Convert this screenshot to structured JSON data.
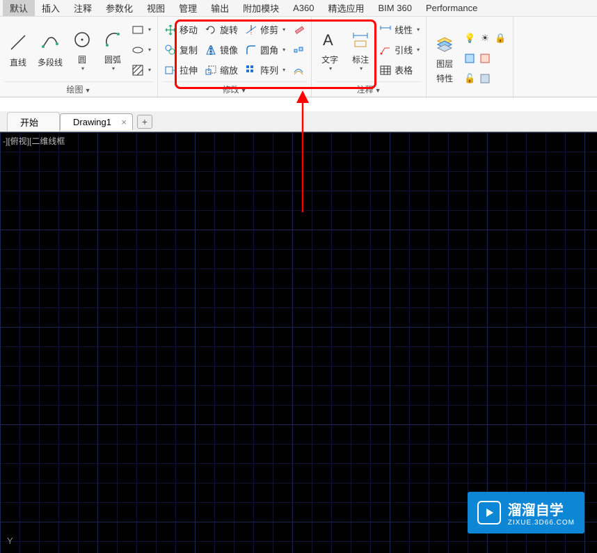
{
  "menus": [
    "默认",
    "插入",
    "注释",
    "参数化",
    "视图",
    "管理",
    "输出",
    "附加模块",
    "A360",
    "精选应用",
    "BIM 360",
    "Performance"
  ],
  "draw": {
    "line": "直线",
    "polyline": "多段线",
    "circle": "圆",
    "arc": "圆弧",
    "panel_label": "绘图"
  },
  "modify": {
    "move": "移动",
    "rotate": "旋转",
    "trim": "修剪",
    "copy": "复制",
    "mirror": "镜像",
    "fillet": "圆角",
    "stretch": "拉伸",
    "scale": "缩放",
    "array": "阵列",
    "panel_label": "修改"
  },
  "annotate": {
    "text": "文字",
    "dim": "标注",
    "linear": "线性",
    "leader": "引线",
    "table": "表格",
    "panel_label": "注释"
  },
  "layer": {
    "label": "图层",
    "props": "特性"
  },
  "tabs": {
    "start": "开始",
    "drawing": "Drawing1"
  },
  "canvas": {
    "viewport": "-][俯视][二维线框",
    "axis": "Y"
  },
  "watermark": {
    "text": "溜溜自学",
    "url": "ZIXUE.3D66.COM"
  }
}
